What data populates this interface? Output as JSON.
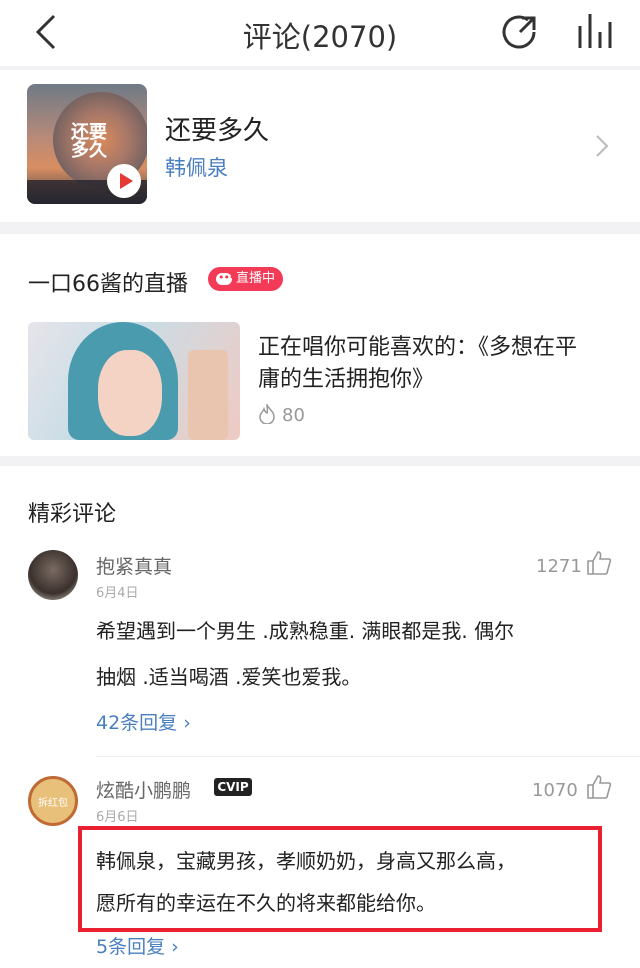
{
  "header": {
    "title": "评论(2070)",
    "icons": [
      "back-chevron-icon",
      "share-icon",
      "equalizer-icon"
    ]
  },
  "song": {
    "name": "还要多久",
    "artist": "韩佩泉",
    "cover_text": "还要多久"
  },
  "live": {
    "title": "一口66酱的直播",
    "badge": "直播中",
    "description": "正在唱你可能喜欢的：《多想在平庸的生活拥抱你》",
    "heat": "80"
  },
  "comments": {
    "section_title": "精彩评论",
    "items": [
      {
        "username": "抱紧真真",
        "date": "6月4日",
        "likes": "1271",
        "text_line1": "希望遇到一个男生 .成熟稳重. 满眼都是我. 偶尔",
        "text_line2": "抽烟 .适当喝酒 .爱笑也爱我。",
        "replies": "42条回复 ›"
      },
      {
        "username": "炫酷小鹏鹏",
        "badge": "CVIP",
        "avatar_text": "拆红包",
        "date": "6月6日",
        "likes": "1070",
        "text_line1": "韩佩泉，宝藏男孩，孝顺奶奶，身高又那么高，",
        "text_line2": "愿所有的幸运在不久的将来都能给你。",
        "replies": "5条回复 ›"
      }
    ]
  },
  "colors": {
    "link": "#4a7fbf",
    "accent": "#f33b57",
    "highlight_border": "#e8202f"
  }
}
